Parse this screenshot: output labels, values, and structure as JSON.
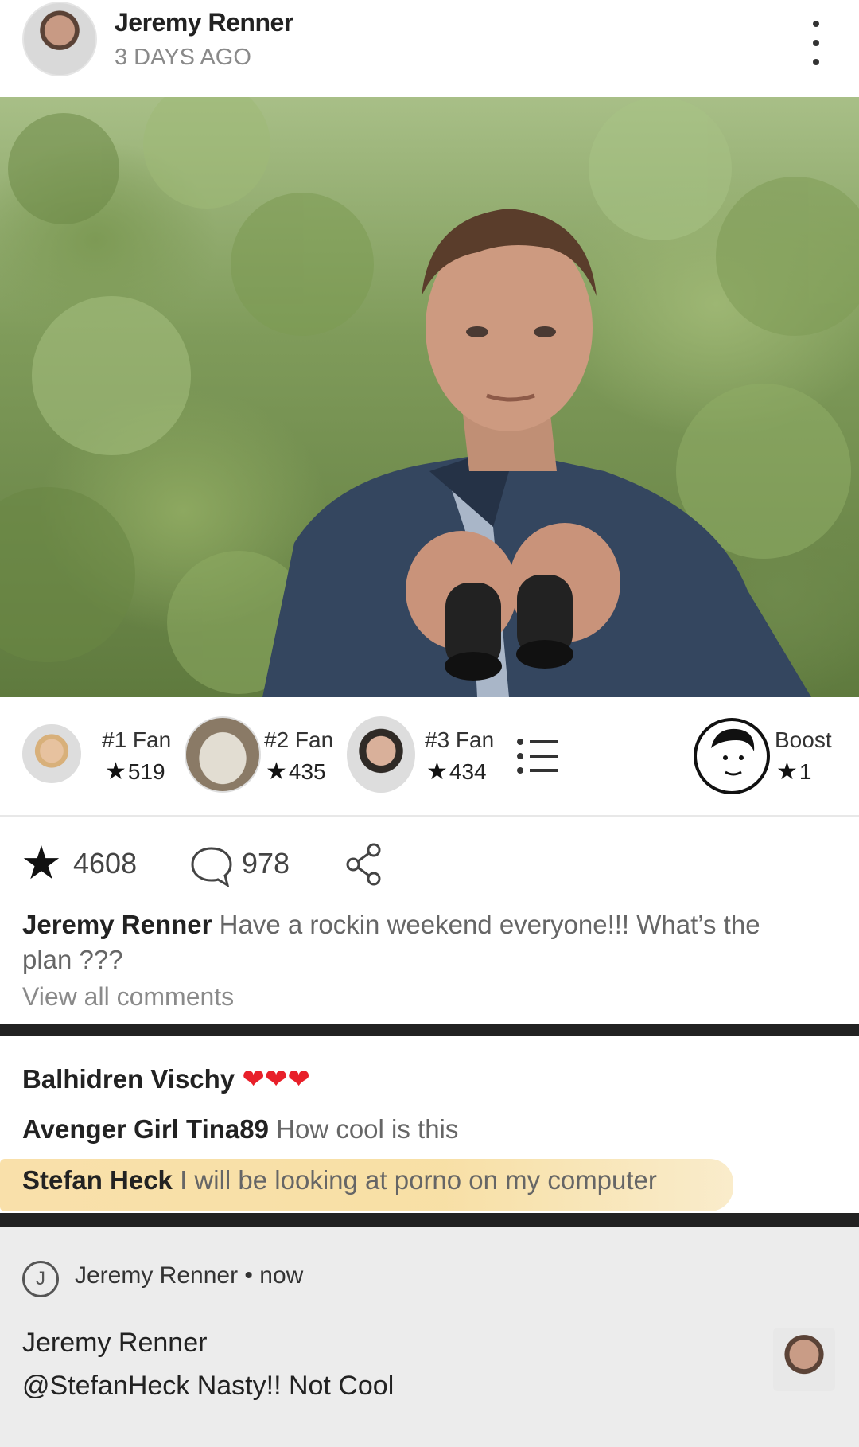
{
  "post": {
    "author": "Jeremy Renner",
    "time": "3 DAYS AGO"
  },
  "fans": [
    {
      "rank": "#1 Fan",
      "score": "519"
    },
    {
      "rank": "#2 Fan",
      "score": "435"
    },
    {
      "rank": "#3 Fan",
      "score": "434"
    }
  ],
  "boost": {
    "label": "Boost",
    "score": "1"
  },
  "actions": {
    "stars": "4608",
    "comments": "978"
  },
  "caption": {
    "author": "Jeremy Renner",
    "text": "Have a rockin weekend everyone!!! What’s the",
    "text2": "plan ???"
  },
  "view_all": "View all comments",
  "comments": [
    {
      "author": "Balhidren Vischy",
      "text": "❤❤❤"
    },
    {
      "author": "Avenger Girl Tina89",
      "text": "How cool is this"
    },
    {
      "author": "Stefan Heck",
      "text": "I will be looking at porno on my computer"
    }
  ],
  "notification": {
    "badge": "J",
    "source": "Jeremy Renner",
    "sep": "•",
    "time": "now",
    "title": "Jeremy Renner",
    "body": "@StefanHeck Nasty!! Not Cool"
  },
  "colors": {
    "heart": "#e8202a",
    "highlight": "#f6d68e"
  }
}
